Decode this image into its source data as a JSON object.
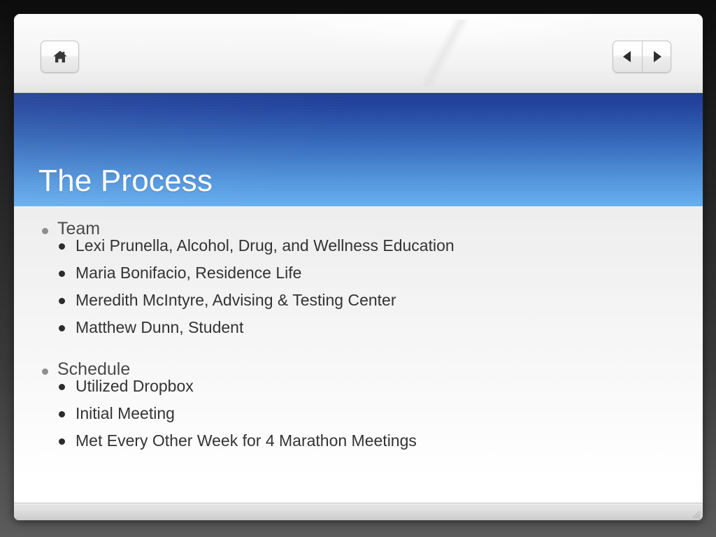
{
  "window": {
    "title": "The Process"
  },
  "toolbar": {
    "home_button": {
      "icon": "home-icon",
      "label": "Home"
    },
    "previous_button": {
      "icon": "triangle-left-icon",
      "label": "Previous"
    },
    "next_button": {
      "icon": "triangle-right-icon",
      "label": "Next"
    }
  },
  "slide": {
    "title": "The Process",
    "title_band": {
      "gradient_top": "#1f3d96",
      "gradient_bottom": "#68b0ef",
      "title_color": "#ffffff"
    },
    "content": {
      "background_top": "#eeeeee",
      "background_bottom": "#ffffff",
      "bullet_color_level1": "#8e8e8e",
      "bullet_color_level2": "#2b2b2b",
      "text_color": "#333333",
      "groups": [
        {
          "heading": "Team",
          "items": [
            "Lexi Prunella, Alcohol, Drug, and Wellness Education",
            "Maria Bonifacio, Residence Life",
            "Meredith McIntyre, Advising & Testing Center",
            "Matthew Dunn, Student"
          ]
        },
        {
          "heading": "Schedule",
          "items": [
            "Utilized Dropbox",
            "Initial Meeting",
            "Met Every Other Week for 4 Marathon Meetings"
          ]
        }
      ]
    }
  },
  "status_bar": {
    "resize_grip": "resize-grip-icon"
  }
}
